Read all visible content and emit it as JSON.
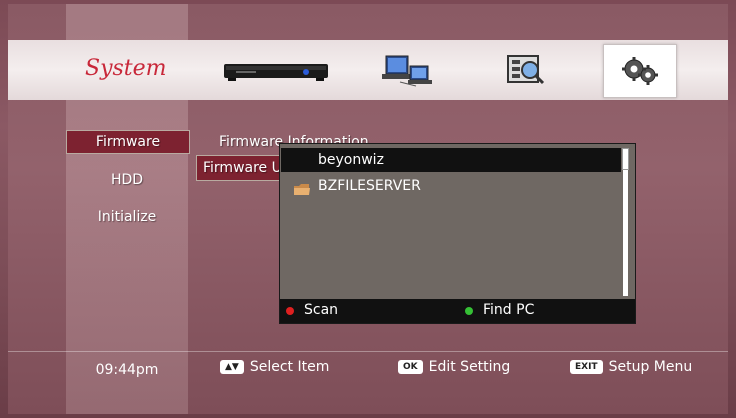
{
  "header": {
    "title": "System",
    "categories": [
      "receiver-icon",
      "network-pcs-icon",
      "media-search-icon",
      "settings-gears-icon"
    ],
    "selected_category": "settings-gears-icon"
  },
  "sidebar": {
    "items": [
      {
        "label": "Firmware",
        "selected": true
      },
      {
        "label": "HDD",
        "selected": false
      },
      {
        "label": "Initialize",
        "selected": false
      }
    ]
  },
  "main": {
    "items": [
      {
        "label": "Firmware Information",
        "selected": false
      },
      {
        "label": "Firmware Upgrade",
        "selected": true
      }
    ]
  },
  "dialog": {
    "rows": [
      {
        "label": "beyonwiz",
        "icon": "",
        "selected": true
      },
      {
        "label": "BZFILESERVER",
        "icon": "folder-icon",
        "selected": false
      }
    ],
    "buttons": {
      "red": "Scan",
      "green": "Find PC"
    }
  },
  "footer": {
    "time": "09:44pm",
    "hints": [
      {
        "key": "▲▼",
        "label": "Select Item"
      },
      {
        "key": "OK",
        "label": "Edit Setting"
      },
      {
        "key": "EXIT",
        "label": "Setup Menu"
      }
    ]
  },
  "colors": {
    "accent_red": "#c8283a",
    "selected_bg": "#7d2230",
    "dialog_bg": "#6f6863"
  }
}
